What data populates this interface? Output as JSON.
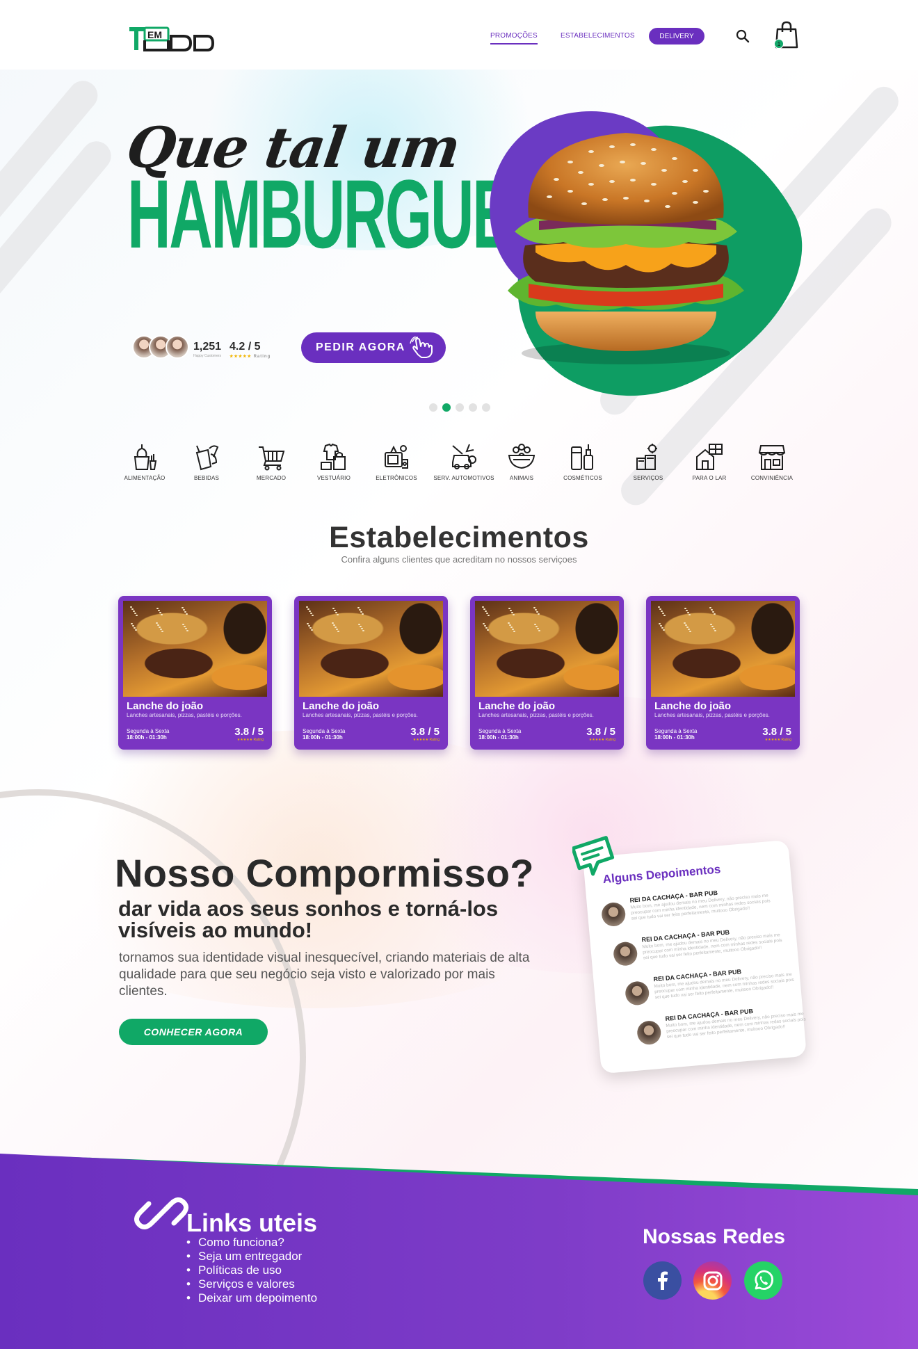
{
  "brand": {
    "logo_text_left": "T",
    "logo_text_em": "EM",
    "logo_text_right": "UDO"
  },
  "colors": {
    "purple": "#6a2fbf",
    "green": "#10a866",
    "dark": "#2a2a2a"
  },
  "nav": {
    "promocoes": "PROMOÇÕES",
    "estabelecimentos": "ESTABELECIMENTOS",
    "delivery": "DELIVERY",
    "cart_count": "1",
    "icons": [
      "search-icon",
      "shopping-bag-icon"
    ]
  },
  "hero": {
    "line1": "Que tal um",
    "line2": "HAMBURGUER?",
    "customers_count": "1,251",
    "customers_label": "Happy Customers",
    "rating": "4.2 / 5",
    "rating_label": "Rating",
    "cta": "PEDIR AGORA",
    "slide_active": 2,
    "slide_total": 5
  },
  "categories": [
    {
      "label": "ALIMENTAÇÃO",
      "icon": "food-icon"
    },
    {
      "label": "BEBIDAS",
      "icon": "drinks-icon"
    },
    {
      "label": "MERCADO",
      "icon": "cart-icon"
    },
    {
      "label": "VESTUÁRIO",
      "icon": "clothes-icon"
    },
    {
      "label": "ELETRÔNICOS",
      "icon": "electronics-icon"
    },
    {
      "label": "SERV. AUTOMOTIVOS",
      "icon": "car-service-icon"
    },
    {
      "label": "ANIMAIS",
      "icon": "pets-icon"
    },
    {
      "label": "COSMÉTICOS",
      "icon": "cosmetics-icon"
    },
    {
      "label": "SERVIÇOS",
      "icon": "services-icon"
    },
    {
      "label": "PARA O LAR",
      "icon": "home-icon"
    },
    {
      "label": "CONVINIÊNCIA",
      "icon": "store-icon"
    }
  ],
  "establishments": {
    "title": "Estabelecimentos",
    "subtitle": "Confira alguns clientes que acreditam no nossos serviçoes",
    "cards": [
      {
        "name": "Lanche do joão",
        "desc": "Lanches artesanais, pizzas, pastéis e porções.",
        "days": "Segunda à Sexta",
        "hours": "18:00h - 01:30h",
        "rating": "3.8 / 5",
        "rating_label": "★★★★★ Rating"
      },
      {
        "name": "Lanche do joão",
        "desc": "Lanches artesanais, pizzas, pastéis e porções.",
        "days": "Segunda à Sexta",
        "hours": "18:00h - 01:30h",
        "rating": "3.8 / 5",
        "rating_label": "★★★★★ Rating"
      },
      {
        "name": "Lanche do joão",
        "desc": "Lanches artesanais, pizzas, pastéis e porções.",
        "days": "Segunda à Sexta",
        "hours": "18:00h - 01:30h",
        "rating": "3.8 / 5",
        "rating_label": "★★★★★ Rating"
      },
      {
        "name": "Lanche do joão",
        "desc": "Lanches artesanais, pizzas, pastéis e porções.",
        "days": "Segunda à Sexta",
        "hours": "18:00h - 01:30h",
        "rating": "3.8 / 5",
        "rating_label": "★★★★★ Rating"
      }
    ]
  },
  "compromisso": {
    "title": "Nosso Compormisso?",
    "subtitle": "dar vida aos seus sonhos e torná-los visíveis ao mundo!",
    "text": "tornamos sua identidade visual inesquecível, criando materiais de alta qualidade para que seu negócio seja visto e valorizado por mais clientes.",
    "cta": "CONHECER AGORA"
  },
  "testimonials": {
    "title": "Alguns Depoimentos",
    "items": [
      {
        "name": "REI DA CACHAÇA - BAR PUB",
        "text": "Muito bom, me ajudou demais no meu Delivery, não preciso mais me preocupar com minha identidade, nem com minhas redes sociais pois sei que tudo vai ser feito perfeitamente, muitooo Obrigado!!"
      },
      {
        "name": "REI DA CACHAÇA - BAR PUB",
        "text": "Muito bom, me ajudou demais no meu Delivery, não preciso mais me preocupar com minha identidade, nem com minhas redes sociais pois sei que tudo vai ser feito perfeitamente, muitooo Obrigado!!"
      },
      {
        "name": "REI DA CACHAÇA - BAR PUB",
        "text": "Muito bom, me ajudou demais no meu Delivery, não preciso mais me preocupar com minha identidade, nem com minhas redes sociais pois sei que tudo vai ser feito perfeitamente, muitooo Obrigado!!"
      },
      {
        "name": "REI DA CACHAÇA - BAR PUB",
        "text": "Muito bom, me ajudou demais no meu Delivery, não preciso mais me preocupar com minha identidade, nem com minhas redes sociais pois sei que tudo vai ser feito perfeitamente, muitooo Obrigado!!"
      }
    ]
  },
  "footer": {
    "links_title": "Links uteis",
    "links": [
      "Como funciona?",
      "Seja um entregador",
      "Políticas de uso",
      "Serviços e valores",
      "Deixar um depoimento"
    ],
    "redes_title": "Nossas Redes",
    "socials": [
      "facebook-icon",
      "instagram-icon",
      "whatsapp-icon"
    ]
  }
}
